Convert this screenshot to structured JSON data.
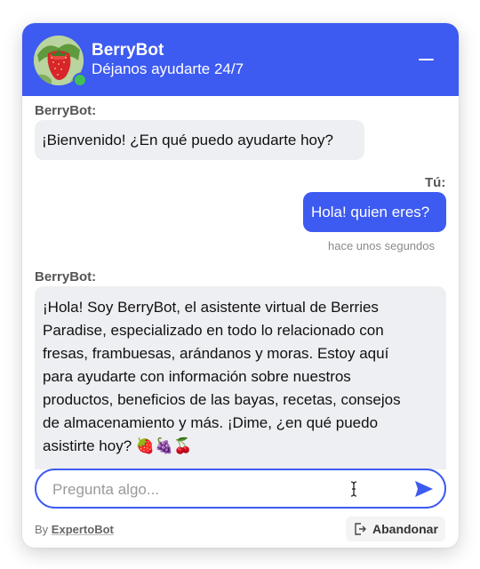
{
  "header": {
    "bot_name": "BerryBot",
    "tagline": "Déjanos ayudarte 24/7",
    "minimize_icon": "minimize-icon"
  },
  "messages": [
    {
      "sender": "BerryBot:",
      "role": "bot",
      "text": "¡Bienvenido! ¿En qué puedo ayudarte hoy?"
    },
    {
      "sender": "Tú:",
      "role": "user",
      "text": "Hola! quien eres?",
      "timestamp": "hace unos segundos"
    },
    {
      "sender": "BerryBot:",
      "role": "bot",
      "lines": [
        "¡Hola! Soy BerryBot, el asistente virtual de Berries",
        "Paradise, especializado en todo lo relacionado con",
        "fresas, frambuesas, arándanos y moras. Estoy aquí",
        "para ayudarte con información sobre nuestros",
        "productos, beneficios de las bayas, recetas, consejos",
        "de almacenamiento y más. ¡Dime, ¿en qué puedo",
        "asistirte hoy? 🍓🍇🍒"
      ]
    }
  ],
  "input": {
    "placeholder": "Pregunta algo...",
    "value": ""
  },
  "footer": {
    "by_label": "By",
    "brand": "ExpertoBot",
    "leave_label": "Abandonar"
  },
  "colors": {
    "accent": "#3d5af1",
    "online": "#40c057",
    "bot_bubble": "#eeeff2"
  }
}
